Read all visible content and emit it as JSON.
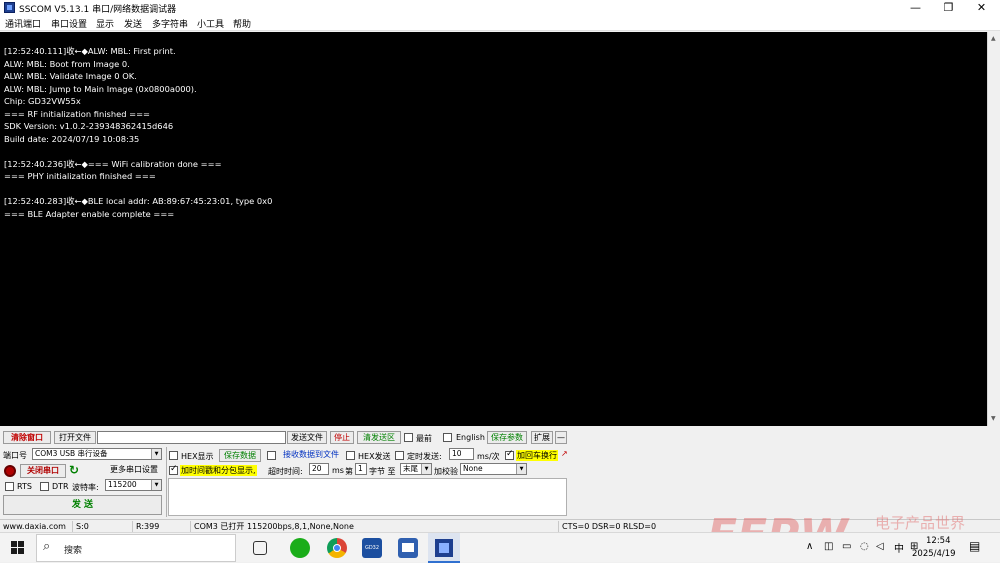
{
  "window": {
    "title": "SSCOM V5.13.1 串口/网络数据调试器",
    "controls": {
      "minimize": "—",
      "maximize": "❐",
      "close": "✕"
    }
  },
  "menu": [
    "通讯端口",
    "串口设置",
    "显示",
    "发送",
    "多字符串",
    "小工具",
    "帮助"
  ],
  "terminal": {
    "lines": [
      "[12:52:40.111]收←◆ALW: MBL: First print.",
      "ALW: MBL: Boot from Image 0.",
      "ALW: MBL: Validate Image 0 OK.",
      "ALW: MBL: Jump to Main Image (0x0800a000).",
      "Chip: GD32VW55x",
      "=== RF initialization finished ===",
      "SDK Version: v1.0.2-239348362415d646",
      "Build date: 2024/07/19 10:08:35",
      "",
      "[12:52:40.236]收←◆=== WiFi calibration done ===",
      "=== PHY initialization finished ===",
      "",
      "[12:52:40.283]收←◆BLE local addr: AB:89:67:45:23:01, type 0x0",
      "=== BLE Adapter enable complete ==="
    ]
  },
  "toolbar": {
    "clear_window": "清除窗口",
    "open_file": "打开文件",
    "file_path": "",
    "send_file": "发送文件",
    "stop": "停止",
    "clear_send": "清发送区",
    "topmost": "最前",
    "english": "English",
    "save_params": "保存参数",
    "expand": "扩展",
    "collapse": "—"
  },
  "port": {
    "port_label": "端口号",
    "port_value": "COM3 USB 串行设备",
    "close_port": "关闭串口",
    "more_settings": "更多串口设置",
    "rts": "RTS",
    "dtr": "DTR",
    "baud_label": "波特率:",
    "baud_value": "115200",
    "send": "发 送"
  },
  "options": {
    "hex_display": "HEX显示",
    "save_data": "保存数据",
    "recv_to_file": "接收数据到文件",
    "hex_send": "HEX发送",
    "timed_send": "定时发送:",
    "interval": "10",
    "interval_unit": "ms/次",
    "add_crlf": "加回车换行",
    "timestamp_split": "加时间戳和分包显示,",
    "timeout_label": "超时时间:",
    "timeout_value": "20",
    "timeout_unit": "ms",
    "byte_prefix": "第",
    "byte_index": "1",
    "byte_label": "字节 至",
    "byte_end": "末尾",
    "checksum_label": "加校验",
    "checksum_value": "None"
  },
  "status_bar": {
    "website": "www.daxia.com",
    "sent": "S:0",
    "received": "R:399",
    "port_status": "COM3 已打开  115200bps,8,1,None,None",
    "lines": "CTS=0 DSR=0 RLSD=0"
  },
  "taskbar": {
    "search": "搜索",
    "time": "12:54",
    "date": "2025/4/19",
    "ime": "中",
    "gd32_label": "GD32"
  },
  "watermark": {
    "logo": "EEPW",
    "tagline": "电子产品世界"
  }
}
